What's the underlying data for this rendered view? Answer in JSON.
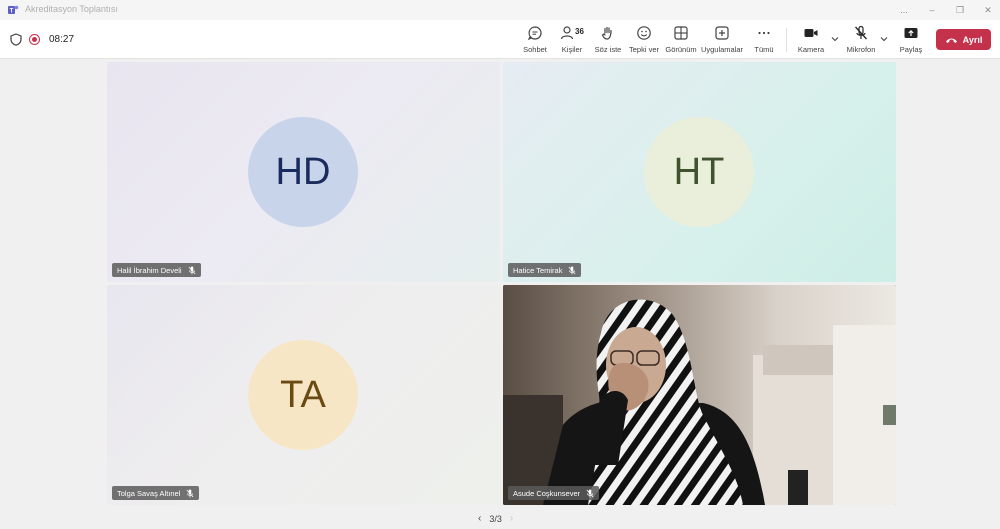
{
  "window": {
    "title": "Akreditasyon Toplantısı",
    "controls": [
      "...",
      "–",
      "❐",
      "✕"
    ]
  },
  "toolbar": {
    "timer": "08:27",
    "buttons": {
      "chat": "Sohbet",
      "people": "Kişiler",
      "people_count": "36",
      "raise_hand": "Söz iste",
      "react": "Tepki ver",
      "view": "Görünüm",
      "apps": "Uygulamalar",
      "more": "Tümü",
      "camera": "Kamera",
      "mic": "Mikrofon",
      "share": "Paylaş"
    },
    "leave": "Ayrıl"
  },
  "participants": [
    {
      "name": "Halil İbrahim Develi",
      "initials": "HD",
      "muted": true
    },
    {
      "name": "Hatice Temirak",
      "initials": "HT",
      "muted": true
    },
    {
      "name": "Tolga Savaş Altınel",
      "initials": "TA",
      "muted": true
    },
    {
      "name": "Asude Coşkunsever",
      "initials": "",
      "muted": true,
      "video": true
    }
  ],
  "pager": {
    "label": "3/3"
  },
  "colors": {
    "leave": "#c4314b",
    "teams_purple": "#5b5fc7"
  }
}
